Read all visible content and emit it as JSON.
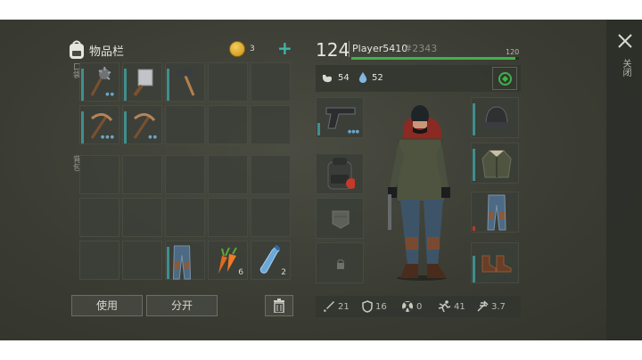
{
  "inventory": {
    "title": "物品栏",
    "coins": "3",
    "add_label": "+",
    "pocket_label": "口袋",
    "backpack_label": "背包",
    "pocket_slots": [
      {
        "item": "spiked-mace",
        "dots": "●●"
      },
      {
        "item": "cleaver",
        "dots": ""
      },
      {
        "item": "hammer",
        "dots": ""
      },
      {
        "item": "",
        "dots": ""
      },
      {
        "item": "",
        "dots": ""
      },
      {
        "item": "pickaxe",
        "dots": "●●●"
      },
      {
        "item": "pickaxe",
        "dots": "●●"
      },
      {
        "item": "",
        "dots": ""
      },
      {
        "item": "",
        "dots": ""
      },
      {
        "item": "",
        "dots": ""
      }
    ],
    "backpack_slots": [
      {
        "item": "",
        "count": ""
      },
      {
        "item": "",
        "count": ""
      },
      {
        "item": "",
        "count": ""
      },
      {
        "item": "",
        "count": ""
      },
      {
        "item": "",
        "count": ""
      },
      {
        "item": "",
        "count": ""
      },
      {
        "item": "",
        "count": ""
      },
      {
        "item": "",
        "count": ""
      },
      {
        "item": "",
        "count": ""
      },
      {
        "item": "",
        "count": ""
      },
      {
        "item": "",
        "count": ""
      },
      {
        "item": "",
        "count": ""
      },
      {
        "item": "jeans",
        "count": ""
      },
      {
        "item": "carrots",
        "count": "6"
      },
      {
        "item": "water-bottle",
        "count": "2"
      }
    ],
    "use_button": "使用",
    "split_button": "分开"
  },
  "player": {
    "level": "124",
    "name": "Player5410",
    "tag": "#2343",
    "xp_max": "120",
    "xp_fraction": 0.98,
    "hunger": "54",
    "water": "52"
  },
  "equipment": {
    "left": [
      "pistol",
      "backpack",
      "pocket-pouch",
      "lock"
    ],
    "right": [
      "beanie",
      "jacket",
      "jeans",
      "boots"
    ]
  },
  "stats": {
    "attack": "21",
    "defense": "16",
    "radiation": "0",
    "speed": "41",
    "weight": "3.7"
  },
  "close_label": "关闭",
  "colors": {
    "accent_green": "#3fb34a",
    "teal_bar": "#3f8f8d",
    "coin_gold": "#d9a521",
    "background": "#3b3d34"
  }
}
